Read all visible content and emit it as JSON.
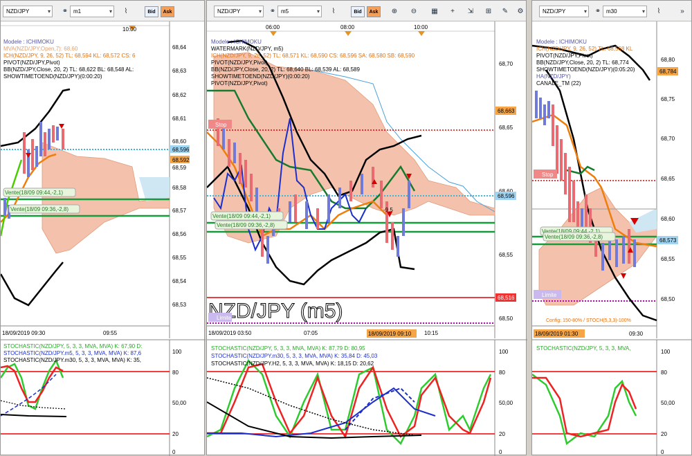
{
  "panes": [
    {
      "symbol": "NZD/JPY",
      "timeframe": "m1",
      "time_top": "10:00",
      "prices_right": [
        "68,64",
        "68,63",
        "68,62",
        "68,61",
        "68,60",
        "68,59",
        "68,58",
        "68,57",
        "68,56",
        "68,55",
        "68,54",
        "68,53"
      ],
      "time_bottom": [
        "18/09/2019 09:30",
        "09:55"
      ],
      "labels": [
        "Modele : ICHIMOKU",
        "MVA(NZD/JPY,Open,7): 68,60",
        "ICH(NZD/JPY, 9, 26, 52) TL: 68,594 KL: 68,572 CS: 6",
        "PIVOT(NZD/JPY,Pivot)",
        "BB(NZD/JPY,Close, 20, 2) TL: 68,622 BL: 68,548 AL:",
        "SHOWTIMETOEND(NZD/JPY)(0:00:20)"
      ],
      "tags": [
        "68,596",
        "68,592"
      ],
      "orders": [
        "Vente(18/09 09:44,-2,1)",
        "Vente(18/09 09:36,-2,8)"
      ],
      "stoch_labels": [
        "STOCHASTIC(NZD/JPY, 5, 3, 3, MVA, MVA) K: 67,90 D:",
        "STOCHASTIC(NZD/JPY.m5, 5, 3, 3, MVA, MVA) K: 87,6",
        "STOCHASTIC(NZD/JPY.m30, 5, 3, 3, MVA, MVA) K: 35,"
      ],
      "stoch_scale": [
        "100",
        "80",
        "50,00",
        "20",
        "0"
      ]
    },
    {
      "symbol": "NZD/JPY",
      "timeframe": "m5",
      "time_top": [
        "06:00",
        "08:00",
        "10:00"
      ],
      "prices_right": [
        "68,70",
        "68,65",
        "68,60",
        "68,55",
        "68,50"
      ],
      "time_bottom": [
        "18/09/2019 03:50",
        "07:05",
        "18/09/2019 09:10",
        "10:15"
      ],
      "labels": [
        "Modele : ICHIMOKU",
        "WATERMARK(NZD/JPY, m5)",
        "ICH(NZD/JPY, 9, 26, 52) TL: 68,571 KL: 68,590 CS: 68,596 SA: 68,580 SB: 68,590",
        "PIVOT(NZD/JPY,Pivot)",
        "BB(NZD/JPY,Close, 20, 2) TL: 68,640 BL: 68,539 AL: 68,589",
        "SHOWTIMETOEND(NZD/JPY)(0:00:20)",
        "PIVOT(NZD/JPY,Pivot)"
      ],
      "tags": [
        "68,663",
        "68,596",
        "68,516"
      ],
      "stop": "Stop",
      "limite": "Limite",
      "watermark": "NZD/JPY (m5)",
      "mark": "-9,5",
      "orders": [
        "Vente(18/09 09:44,-2,1)",
        "Vente(18/09 09:36,-2,8)"
      ],
      "stoch_labels": [
        "STOCHASTIC(NZD/JPY, 5, 3, 3, MVA, MVA) K: 87,79 D: 80,95",
        "STOCHASTIC(NZD/JPY.m30, 5, 3, 3, MVA, MVA) K: 35,84 D: 45,03",
        "STOCHASTIC(NZD/JPY.H2, 5, 3, 3, MVA, MVA) K: 18,15 D: 20,62"
      ],
      "stoch_scale": [
        "100",
        "80",
        "50,00",
        "20",
        "0"
      ]
    },
    {
      "symbol": "NZD/JPY",
      "timeframe": "m30",
      "prices_right": [
        "68,80",
        "68,75",
        "68,70",
        "68,65",
        "68,60",
        "68,55",
        "68,50"
      ],
      "time_bottom": [
        "18/09/2019 01:30",
        "09:30"
      ],
      "labels": [
        "Modele : ICHIMOKU",
        "ICH(NZD/JPY, 9, 26, 52) TL: 68,568 KL",
        "PIVOT(NZD/JPY,Pivot)",
        "BB(NZD/JPY,Close, 20, 2) TL: 68,774",
        "SHOWTIMETOEND(NZD/JPY)(0:05:20)",
        "HA(NZD/JPY)",
        "CANALE_TM (22)"
      ],
      "tags": [
        "68,784",
        "68,573"
      ],
      "stop": "Stop",
      "limite": "Limite",
      "orders": [
        "Vente(18/09 09:44,-2,1)",
        "Vente(18/09 09:36,-2,8)"
      ],
      "config": "Config: 150-80% / STOCH(5,3,3)-100%",
      "stoch_labels": [
        "STOCHASTIC(NZD/JPY, 5, 3, 3, MVA,"
      ],
      "stoch_scale": [
        "100",
        "80",
        "50,00",
        "20",
        "0"
      ]
    }
  ],
  "toolbar": {
    "bid": "Bid",
    "ask": "Ask"
  }
}
